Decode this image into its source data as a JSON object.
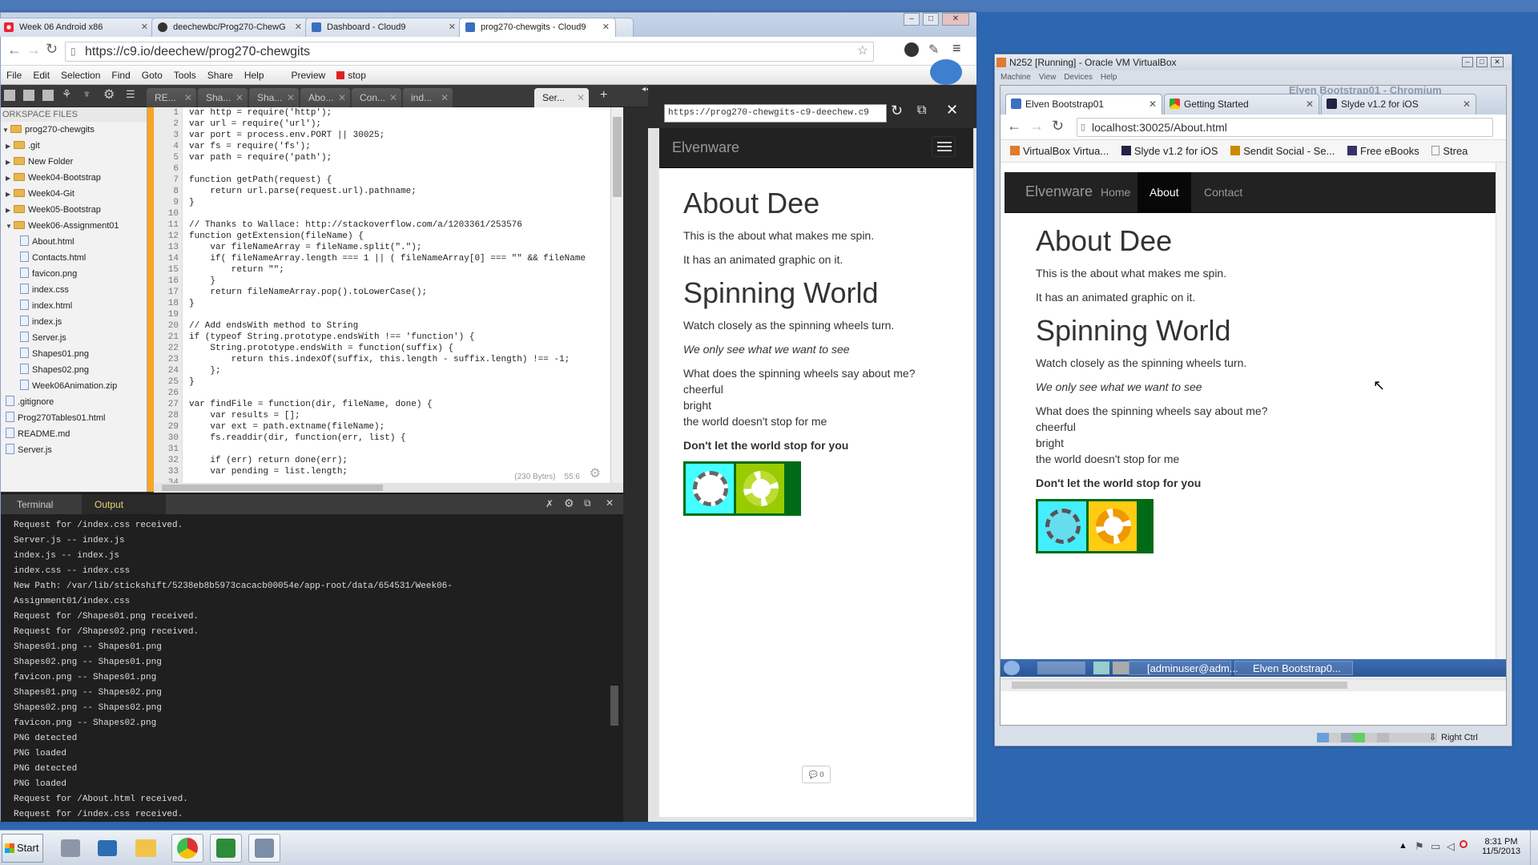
{
  "chrome": {
    "tabs": [
      {
        "label": "Week 06 Android x86",
        "icon": "red-spinner-icon"
      },
      {
        "label": "deechewbc/Prog270-ChewG",
        "icon": "github-icon"
      },
      {
        "label": "Dashboard - Cloud9",
        "icon": "cloud9-icon"
      },
      {
        "label": "prog270-chewgits - Cloud9",
        "icon": "cloud9-icon"
      }
    ],
    "url": "https://c9.io/deechew/prog270-chewgits"
  },
  "c9": {
    "menu": [
      "File",
      "Edit",
      "Selection",
      "Find",
      "Goto",
      "Tools",
      "Share",
      "Help",
      "Preview",
      "stop"
    ],
    "editor_tabs": [
      "RE...",
      "Sha...",
      "Sha...",
      "Abo...",
      "Con...",
      "ind...",
      "Ser..."
    ],
    "workspace_header": "ORKSPACE FILES",
    "tree": [
      {
        "label": "prog270-chewgits",
        "type": "folder",
        "level": 0
      },
      {
        "label": ".git",
        "type": "folder",
        "level": 1
      },
      {
        "label": "New Folder",
        "type": "folder",
        "level": 1
      },
      {
        "label": "Week04-Bootstrap",
        "type": "folder",
        "level": 1
      },
      {
        "label": "Week04-Git",
        "type": "folder",
        "level": 1
      },
      {
        "label": "Week05-Bootstrap",
        "type": "folder",
        "level": 1
      },
      {
        "label": "Week06-Assignment01",
        "type": "folder",
        "level": 1
      },
      {
        "label": "About.html",
        "type": "file",
        "level": 2
      },
      {
        "label": "Contacts.html",
        "type": "file",
        "level": 2
      },
      {
        "label": "favicon.png",
        "type": "file",
        "level": 2
      },
      {
        "label": "index.css",
        "type": "file",
        "level": 2
      },
      {
        "label": "index.html",
        "type": "file",
        "level": 2
      },
      {
        "label": "index.js",
        "type": "file",
        "level": 2
      },
      {
        "label": "Server.js",
        "type": "file",
        "level": 2
      },
      {
        "label": "Shapes01.png",
        "type": "file",
        "level": 2
      },
      {
        "label": "Shapes02.png",
        "type": "file",
        "level": 2
      },
      {
        "label": "Week06Animation.zip",
        "type": "file",
        "level": 2
      },
      {
        "label": ".gitignore",
        "type": "file",
        "level": 1
      },
      {
        "label": "Prog270Tables01.html",
        "type": "file",
        "level": 1
      },
      {
        "label": "README.md",
        "type": "file",
        "level": 1
      },
      {
        "label": "Server.js",
        "type": "file",
        "level": 1
      }
    ],
    "line_numbers": "1\n2\n3\n4\n5\n6\n7\n8\n9\n10\n11\n12\n13\n14\n15\n16\n17\n18\n19\n20\n21\n22\n23\n24\n25\n26\n27\n28\n29\n30\n31\n32\n33\n34",
    "code": "var http = require('http');\nvar url = require('url');\nvar port = process.env.PORT || 30025;\nvar fs = require('fs');\nvar path = require('path');\n\nfunction getPath(request) {\n    return url.parse(request.url).pathname;\n}\n\n// Thanks to Wallace: http://stackoverflow.com/a/1203361/253576\nfunction getExtension(fileName) {\n    var fileNameArray = fileName.split(\".\");\n    if( fileNameArray.length === 1 || ( fileNameArray[0] === \"\" && fileName\n        return \"\";\n    }\n    return fileNameArray.pop().toLowerCase();\n}\n\n// Add endsWith method to String\nif (typeof String.prototype.endsWith !== 'function') {\n    String.prototype.endsWith = function(suffix) {\n        return this.indexOf(suffix, this.length - suffix.length) !== -1;\n    };\n}\n\nvar findFile = function(dir, fileName, done) {\n    var results = [];\n    var ext = path.extname(fileName);\n    fs.readdir(dir, function(err, list) {\n\n    if (err) return done(err);\n    var pending = list.length;\n",
    "editor_status": {
      "size": "(230 Bytes)",
      "cursor": "55:6"
    },
    "panel_tabs": [
      "Terminal",
      "Output"
    ],
    "output_lines": [
      "Request for /index.css received.",
      "Server.js -- index.js",
      "index.js -- index.js",
      "index.css -- index.css",
      "New Path: /var/lib/stickshift/5238eb8b5973cacacb00054e/app-root/data/654531/Week06-",
      "Assignment01/index.css",
      "Request for /Shapes01.png received.",
      "Request for /Shapes02.png received.",
      "Shapes01.png -- Shapes01.png",
      "Shapes02.png -- Shapes01.png",
      "favicon.png -- Shapes01.png",
      "Shapes01.png -- Shapes02.png",
      "Shapes02.png -- Shapes02.png",
      "favicon.png -- Shapes02.png",
      "PNG detected",
      "PNG loaded",
      "PNG detected",
      "PNG loaded",
      "Request for /About.html received.",
      "Request for /index.css received."
    ]
  },
  "preview": {
    "url": "https://prog270-chewgits-c9-deechew.c9",
    "brand": "Elvenware",
    "comments_count": "0"
  },
  "page": {
    "h1": "About Dee",
    "p1": "This is the about what makes me spin.",
    "p2": "It has an animated graphic on it.",
    "h2": "Spinning World",
    "p3": "Watch closely as the spinning wheels turn.",
    "em": "We only see what we want to see",
    "q": "What does the spinning wheels say about me?",
    "l1": "cheerful",
    "l2": "bright",
    "l3": "the world doesn't stop for me",
    "strong": "Don't let the world stop for you"
  },
  "vbox": {
    "title": "N252 [Running] - Oracle VM VirtualBox",
    "menu": [
      "Machine",
      "View",
      "Devices",
      "Help"
    ],
    "ff_title_faded": "Elven Bootstrap01 - Chromium",
    "ff_tabs": [
      "Elven Bootstrap01",
      "Getting Started",
      "Slyde v1.2 for iOS"
    ],
    "ff_url": "localhost:30025/About.html",
    "bookmarks": [
      "VirtualBox Virtua...",
      "Slyde v1.2 for iOS",
      "Sendit Social - Se...",
      "Free eBooks",
      "Strea"
    ],
    "nav": [
      "Home",
      "About",
      "Contact"
    ],
    "guest_tasks": [
      "[adminuser@adm...",
      "Elven Bootstrap0..."
    ],
    "status_key": "Right Ctrl"
  },
  "taskbar": {
    "start": "Start",
    "time": "8:31 PM",
    "date": "11/5/2013"
  }
}
